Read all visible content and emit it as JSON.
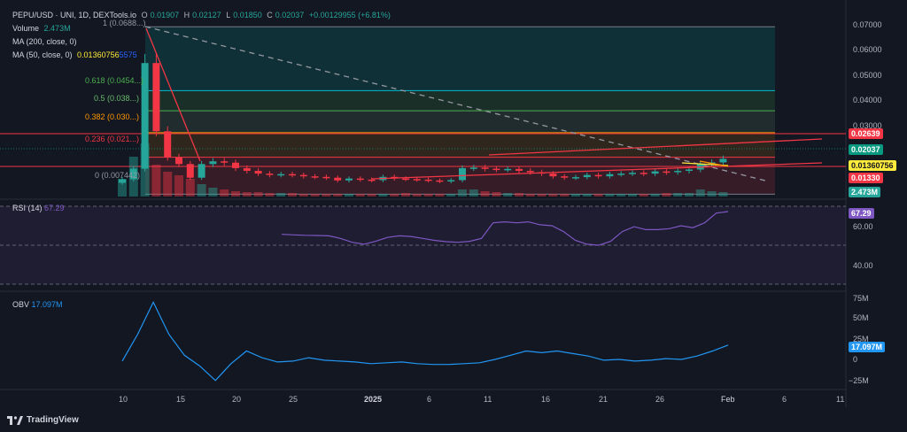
{
  "legend": {
    "symbol": "PEPU/USD · UNI, 1D, DEXTools.io",
    "open_label": "O",
    "open": "0.01907",
    "high_label": "H",
    "high": "0.02127",
    "low_label": "L",
    "low": "0.01850",
    "close_label": "C",
    "close": "0.02037",
    "change": "+0.00129955 (+6.81%)",
    "volume_label": "Volume",
    "volume": "2.473M",
    "ma200_label": "MA (200, close, 0)",
    "ma50_label": "MA (50, close, 0)",
    "ma50_value": "0.01360756",
    "ma50_overlap": "5575"
  },
  "fib_labels": [
    {
      "text": "1 (0.0688...)",
      "color": "#9598a1"
    },
    {
      "text": "0.618 (0.0454...)",
      "color": "#4caf50"
    },
    {
      "text": "0.5 (0.038...)",
      "color": "#66bb6a"
    },
    {
      "text": "0.382 (0.030...)",
      "color": "#ff9800"
    },
    {
      "text": "0.236 (0.021...)",
      "color": "#f23645"
    },
    {
      "text": "0 (0.007442)",
      "color": "#9598a1"
    }
  ],
  "price_axis": [
    "0.07000",
    "0.06000",
    "0.05000",
    "0.04000",
    "0.03000"
  ],
  "price_tags": {
    "p1": {
      "text": "0.02639",
      "bg": "#f23645",
      "fg": "#ffffff"
    },
    "p2": {
      "text": "0.02037",
      "bg": "#089981",
      "fg": "#ffffff"
    },
    "p3": {
      "text": "0.01360756",
      "bg": "#ffeb3b",
      "fg": "#131722"
    },
    "p4": {
      "text": "0.01330",
      "bg": "#f23645",
      "fg": "#ffffff"
    },
    "p5": {
      "text": "2.473M",
      "bg": "#26a69a",
      "fg": "#ffffff"
    }
  },
  "rsi": {
    "label": "RSI (14)",
    "value": "67.29",
    "axis": [
      "60.00",
      "40.00"
    ],
    "tag": "67.29",
    "color": "#7e57c2"
  },
  "obv": {
    "label": "OBV",
    "value": "17.097M",
    "axis": [
      "75M",
      "50M",
      "25M",
      "0",
      "−25M"
    ],
    "tag": "17.097M",
    "color": "#2196f3"
  },
  "time_axis": [
    "10",
    "15",
    "20",
    "25",
    "2025",
    "6",
    "11",
    "16",
    "21",
    "26",
    "Feb",
    "6",
    "11"
  ],
  "brand": "TradingView",
  "colors": {
    "up": "#26a69a",
    "down": "#f23645",
    "bg": "#131722"
  },
  "chart_data": {
    "type": "candlestick",
    "title": "PEPU/USD · UNI, 1D, DEXTools.io",
    "x": [
      "Dec 10",
      "Dec 11",
      "Dec 12",
      "Dec 13",
      "Dec 14",
      "Dec 15",
      "Dec 16",
      "Dec 17",
      "Dec 18",
      "Dec 19",
      "Dec 20",
      "Dec 21",
      "Dec 22",
      "Dec 23",
      "Dec 24",
      "Dec 25",
      "Dec 26",
      "Dec 27",
      "Dec 28",
      "Dec 29",
      "Dec 30",
      "Dec 31",
      "Jan 1",
      "Jan 2",
      "Jan 3",
      "Jan 4",
      "Jan 5",
      "Jan 6",
      "Jan 7",
      "Jan 8",
      "Jan 9",
      "Jan 10",
      "Jan 11",
      "Jan 12",
      "Jan 13",
      "Jan 14",
      "Jan 15",
      "Jan 16",
      "Jan 17",
      "Jan 18",
      "Jan 19",
      "Jan 20",
      "Jan 21",
      "Jan 22",
      "Jan 23",
      "Jan 24",
      "Jan 25",
      "Jan 26",
      "Jan 27",
      "Jan 28",
      "Jan 29",
      "Jan 30",
      "Jan 31",
      "Feb 1"
    ],
    "close": [
      0.0129,
      0.0168,
      0.0555,
      0.0305,
      0.021,
      0.0185,
      0.0135,
      0.0185,
      0.0195,
      0.019,
      0.017,
      0.016,
      0.015,
      0.0145,
      0.0148,
      0.0145,
      0.014,
      0.0138,
      0.0135,
      0.0125,
      0.0132,
      0.0128,
      0.0126,
      0.0138,
      0.0132,
      0.013,
      0.0128,
      0.0125,
      0.0122,
      0.0126,
      0.017,
      0.0172,
      0.0168,
      0.0165,
      0.0167,
      0.016,
      0.0155,
      0.015,
      0.014,
      0.0135,
      0.0137,
      0.0145,
      0.014,
      0.0148,
      0.015,
      0.0153,
      0.015,
      0.0158,
      0.0155,
      0.016,
      0.0165,
      0.0185,
      0.0191,
      0.0204
    ],
    "volume_unit": "M",
    "rsi": [
      55.6,
      55.3,
      55.1,
      55.0,
      54.8,
      53.5,
      51.5,
      50.5,
      52.0,
      54.0,
      54.8,
      54.5,
      53.5,
      52.5,
      51.8,
      51.5,
      52.0,
      53.5,
      61.5,
      62.0,
      61.5,
      62.0,
      60.5,
      60.0,
      57.0,
      52.5,
      50.5,
      50.0,
      52.0,
      57.0,
      59.5,
      58.0,
      58.0,
      58.5,
      60.0,
      59.0,
      61.5,
      66.5,
      67.29
    ],
    "obv_millions": [
      -2,
      30,
      68,
      30,
      5,
      -8,
      -25,
      -5,
      10,
      2,
      -3,
      -2,
      2,
      -1,
      -2,
      -3,
      -5,
      -4,
      -3,
      -5,
      -6,
      -6,
      -5,
      -4,
      0,
      5,
      10,
      8,
      10,
      7,
      4,
      -1,
      0,
      -2,
      -1,
      1,
      0,
      4,
      10,
      17.097
    ],
    "rsi_levels": [
      70,
      50,
      30
    ],
    "fib_levels": {
      "1": 0.0688,
      "0.618": 0.0454,
      "0.5": 0.038,
      "0.382": 0.03,
      "0.236": 0.021,
      "0": 0.007442
    },
    "ylim": [
      0.0066,
      0.076
    ]
  }
}
